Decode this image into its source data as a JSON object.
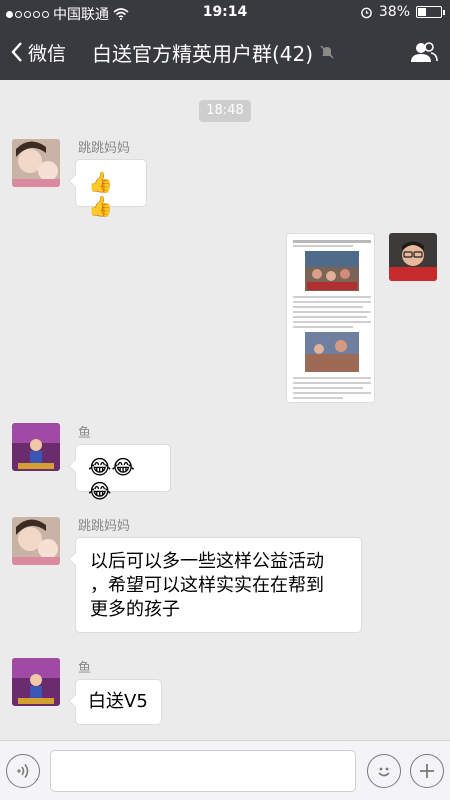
{
  "status": {
    "carrier": "中国联通",
    "time": "19:14",
    "battery": "38%",
    "battery_level": 0.38
  },
  "nav": {
    "back_label": "微信",
    "title": "白送官方精英用户群(42)"
  },
  "chat": {
    "time_stamp": "18:48",
    "messages": [
      {
        "sender": "跳跳妈妈",
        "type": "emoji",
        "emoji": "👍👍"
      },
      {
        "sender": "",
        "type": "image",
        "side": "right"
      },
      {
        "sender": "鱼",
        "type": "emoji",
        "emoji": "😂😂😂"
      },
      {
        "sender": "跳跳妈妈",
        "type": "text",
        "text": "以后可以多一些这样公益活动\n，希望可以这样实实在在帮到\n更多的孩子"
      },
      {
        "sender": "鱼",
        "type": "text",
        "text": "白送V5"
      }
    ]
  },
  "input": {
    "placeholder": ""
  }
}
